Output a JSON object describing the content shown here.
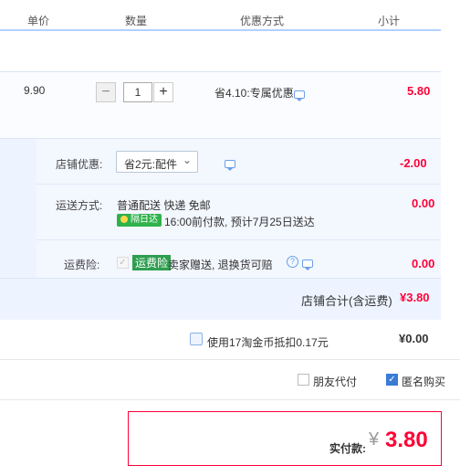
{
  "header": {
    "col_price": "单价",
    "col_qty": "数量",
    "col_discount": "优惠方式",
    "col_subtotal": "小计"
  },
  "item": {
    "price": "9.90",
    "quantity": "1",
    "minus": "−",
    "plus": "+",
    "discount": "省4.10:专属优惠",
    "subtotal": "5.80"
  },
  "shop": {
    "discount_label": "店铺优惠:",
    "discount_selected": "省2元:配件",
    "discount_amount": "-2.00",
    "shipping_label": "运送方式:",
    "shipping_method": "普通配送 快递 免邮",
    "shipping_badge": "隔日达",
    "shipping_note": "16:00前付款, 预计7月25日送达",
    "shipping_amount": "0.00",
    "insurance_label": "运费险:",
    "insurance_tag": "运费险",
    "insurance_text": "卖家赠送, 退换货可赔",
    "insurance_amount": "0.00",
    "total_label": "店铺合计(含运费)",
    "total_amount": "¥3.80"
  },
  "coins": {
    "label": "使用17淘金币抵扣0.17元",
    "amount": "¥0.00"
  },
  "options": {
    "friend_pay": "朋友代付",
    "anonymous": "匿名购买"
  },
  "payment": {
    "label": "实付款:",
    "currency": "¥",
    "amount": "3.80"
  },
  "colors": {
    "accent_red": "#ff0036",
    "accent_blue": "#3a7bd5",
    "section_bg": "#eef4ff"
  }
}
